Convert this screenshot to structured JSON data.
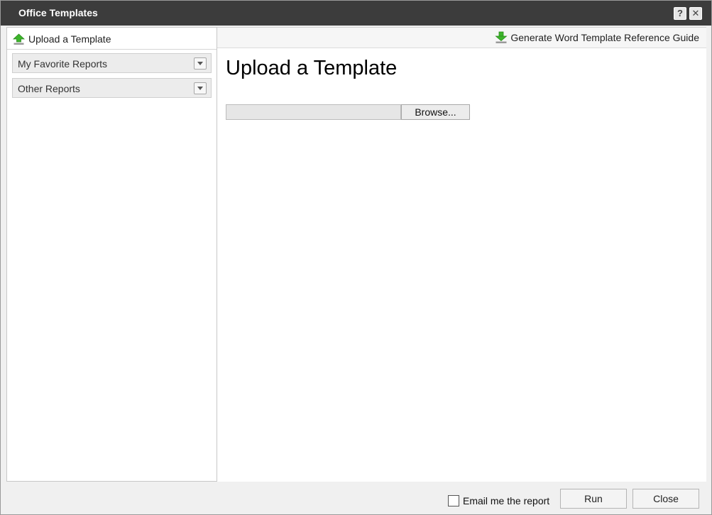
{
  "window": {
    "title": "Office Templates",
    "help_label": "?",
    "close_label": "✕"
  },
  "sidebar": {
    "upload_label": "Upload a Template",
    "upload_icon": "upload-arrow-icon",
    "groups": [
      {
        "label": "My Favorite Reports"
      },
      {
        "label": "Other Reports"
      }
    ]
  },
  "main": {
    "generate_label": "Generate Word Template Reference Guide",
    "generate_icon": "download-arrow-icon",
    "heading": "Upload a Template",
    "browse_label": "Browse...",
    "file_value": ""
  },
  "footer": {
    "email_label": "Email me the report",
    "email_checked": false,
    "run_label": "Run",
    "close_label": "Close"
  },
  "colors": {
    "titlebar": "#3c3c3c",
    "accent_green": "#3db52b"
  }
}
